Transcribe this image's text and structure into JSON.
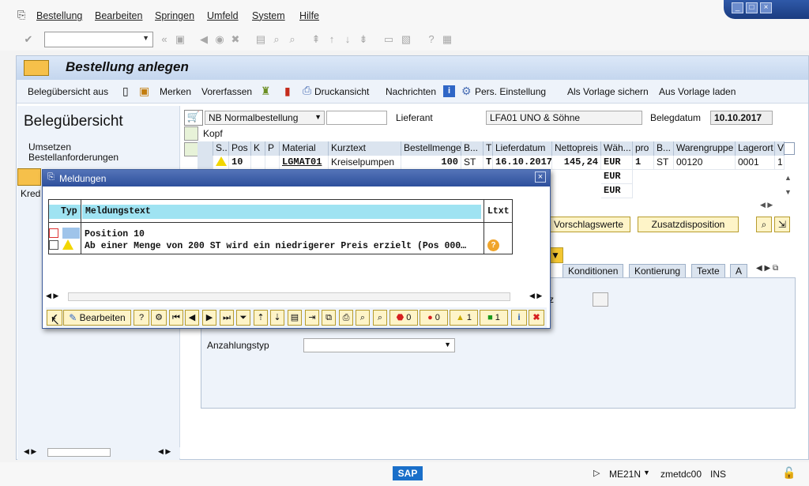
{
  "menu": {
    "items": [
      "Bestellung",
      "Bearbeiten",
      "Springen",
      "Umfeld",
      "System",
      "Hilfe"
    ]
  },
  "header": {
    "title": "Bestellung anlegen"
  },
  "app_toolbar": {
    "overview": "Belegübersicht aus",
    "remember": "Merken",
    "default_values": "Vorerfassen",
    "print_preview": "Druckansicht",
    "messages": "Nachrichten",
    "personal_settings": "Pers. Einstellung",
    "save_template": "Als Vorlage sichern",
    "load_template": "Aus Vorlage laden"
  },
  "left": {
    "title": "Belegübersicht",
    "items": [
      "Umsetzen",
      "Bestellanforderungen"
    ],
    "cut_label": "Kred"
  },
  "po": {
    "type": "NB Normalbestellung",
    "vendor_label": "Lieferant",
    "vendor": "LFA01 UNO & Söhne",
    "doc_date_label": "Belegdatum",
    "doc_date": "10.10.2017",
    "header_label": "Kopf"
  },
  "items_table": {
    "headers": [
      "S..",
      "Pos",
      "K",
      "P",
      "Material",
      "Kurztext",
      "Bestellmenge",
      "B...",
      "T",
      "Lieferdatum",
      "Nettopreis",
      "Wäh...",
      "pro",
      "B...",
      "Warengruppe",
      "Lagerort",
      "V"
    ],
    "row": {
      "pos": "10",
      "material": "LGMAT01",
      "short_text": "Kreiselpumpen",
      "qty": "100",
      "unit": "ST",
      "t": "T",
      "date": "16.10.2017",
      "price": "145,24",
      "currency": "EUR",
      "per": "1",
      "unit2": "ST",
      "group": "00120",
      "storage": "0001",
      "v": "1"
    },
    "extra_currencies": [
      "EUR",
      "EUR"
    ]
  },
  "detail": {
    "btn_proposals": "Vorschlagswerte",
    "btn_additional": "Zusatzdisposition",
    "tabs": [
      "Konditionen",
      "Kontierung",
      "Texte",
      "A"
    ],
    "down_payment_label": "Anzahlungstyp",
    "cut_label": "z"
  },
  "popup": {
    "title": "Meldungen",
    "col_type": "Typ",
    "col_text": "Meldungstext",
    "col_ltxt": "Ltxt",
    "messages": [
      "Position 10",
      "Ab einer Menge von 200 ST wird ein niedrigerer Preis erzielt (Pos 000…"
    ],
    "edit_label": "Bearbeiten",
    "count_stop": "0",
    "count_error": "0",
    "count_warning": "1",
    "count_success": "1"
  },
  "status": {
    "tcode": "ME21N",
    "server": "zmetdc00",
    "mode": "INS",
    "logo": "SAP"
  },
  "colors": {
    "accent": "#2d4f9c",
    "button_yellow": "#fef4c8",
    "panel": "#eef3fa"
  }
}
